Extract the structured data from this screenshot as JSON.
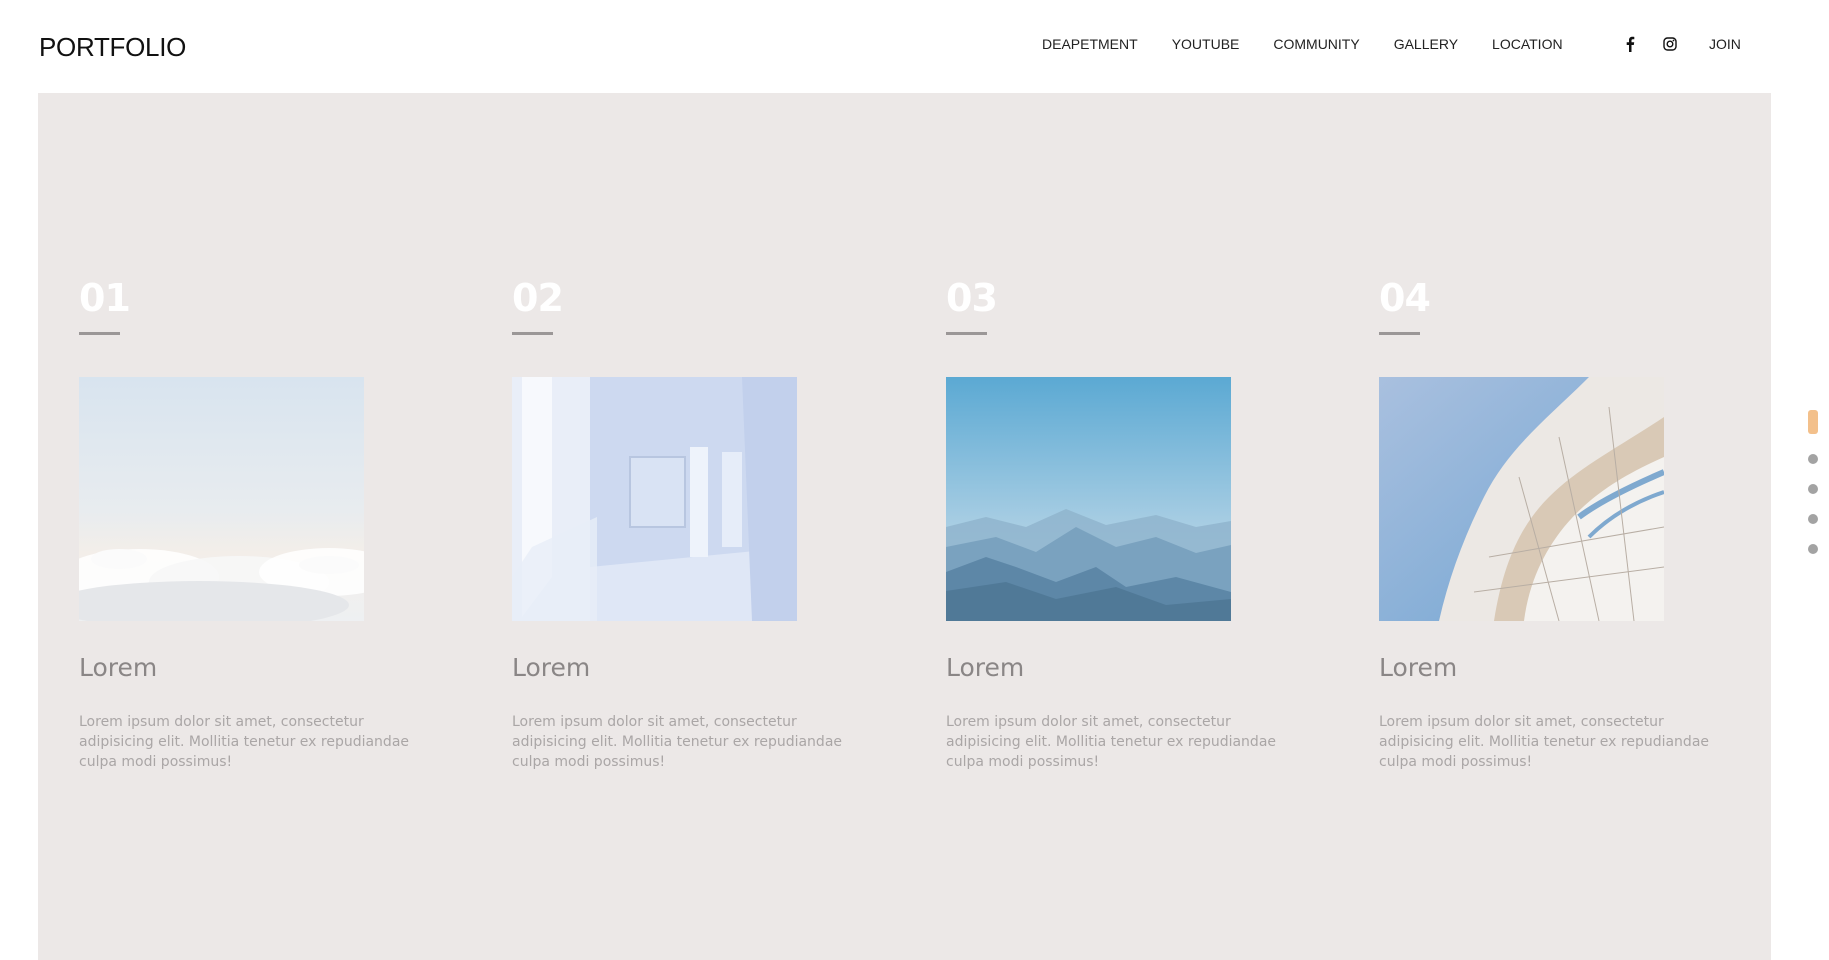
{
  "header": {
    "logo": "PORTFOLIO",
    "nav": [
      "DEAPETMENT",
      "YOUTUBE",
      "COMMUNITY",
      "GALLERY",
      "LOCATION"
    ],
    "social": [
      "facebook-icon",
      "instagram-icon"
    ],
    "join_label": "JOIN"
  },
  "cards": [
    {
      "num": "01",
      "title": "Lorem",
      "desc": "Lorem ipsum dolor sit amet, consectetur adipisicing elit. Mollitia tenetur ex repudiandae culpa modi possimus!",
      "image": "clouds-sky"
    },
    {
      "num": "02",
      "title": "Lorem",
      "desc": "Lorem ipsum dolor sit amet, consectetur adipisicing elit. Mollitia tenetur ex repudiandae culpa modi possimus!",
      "image": "white-hallway"
    },
    {
      "num": "03",
      "title": "Lorem",
      "desc": "Lorem ipsum dolor sit amet, consectetur adipisicing elit. Mollitia tenetur ex repudiandae culpa modi possimus!",
      "image": "mountain-range"
    },
    {
      "num": "04",
      "title": "Lorem",
      "desc": "Lorem ipsum dolor sit amet, consectetur adipisicing elit. Mollitia tenetur ex repudiandae culpa modi possimus!",
      "image": "curved-building"
    }
  ],
  "pager": {
    "count": 5,
    "active_index": 0
  },
  "colors": {
    "panel_bg": "#ece8e7",
    "pager_active": "#f3c08b",
    "pager_dot": "#a3a3a3",
    "title_text": "#8a8686",
    "desc_text": "#aaa6a6"
  }
}
